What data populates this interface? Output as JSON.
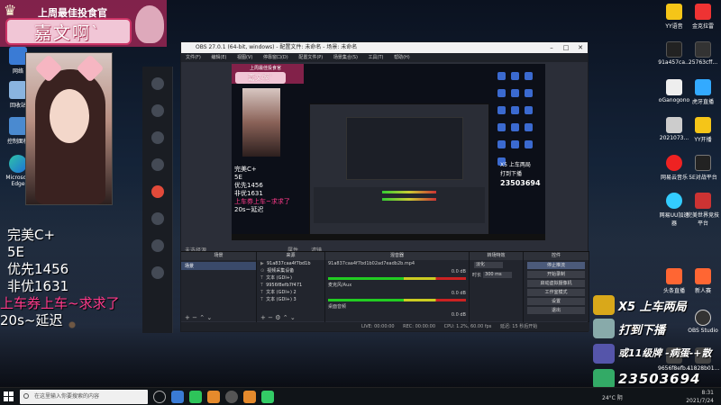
{
  "overlay": {
    "banner_title": "上周最佳投食官",
    "streamer_name": "嘉文啊`",
    "lines": [
      "完美C+",
      "5E",
      "优先1456",
      "非优1631",
      "上车券上车~求求了",
      "20s~延迟"
    ]
  },
  "obs": {
    "title": "OBS 27.0.1 (64-bit, windows) - 配置文件: 未命名 - 场景: 未命名",
    "menu": [
      "文件(F)",
      "编辑(E)",
      "视图(V)",
      "停靠窗口(D)",
      "配置文件(P)",
      "场景集合(S)",
      "工具(T)",
      "帮助(H)"
    ],
    "no_source_label": "未选择源",
    "properties_label": "属性",
    "filters_label": "滤镜",
    "preview": {
      "banner_title": "上周最佳投食官",
      "name": "嘉文啊`",
      "lines": [
        "完美C+",
        "5E",
        "优先1456",
        "非优1631",
        "上车券上车~求求了",
        "20s~延迟"
      ],
      "badges": [
        "X5 上车两局",
        "打到下播",
        "23503694"
      ]
    },
    "docks": {
      "scenes": {
        "title": "场景",
        "items": [
          "场景"
        ]
      },
      "sources": {
        "title": "来源",
        "items": [
          {
            "type": "▶",
            "name": "91a837caa4f7bd1b"
          },
          {
            "type": "⊙",
            "name": "视频采集设备"
          },
          {
            "type": "T",
            "name": "文本 (GDI+)"
          },
          {
            "type": "T",
            "name": "9956f8efb7f471"
          },
          {
            "type": "T",
            "name": "文本 (GDI+) 2"
          },
          {
            "type": "T",
            "name": "文本 (GDI+) 3"
          }
        ]
      },
      "mixer": {
        "title": "混音器",
        "channels": [
          {
            "name": "91a837caa4f7bd1b02ad7eadb2b.mp4",
            "level": "0.0 dB"
          },
          {
            "name": "麦克风/Aux",
            "level": "0.0 dB"
          },
          {
            "name": "桌面音频",
            "level": "0.0 dB"
          }
        ]
      },
      "transitions": {
        "title": "转场特效",
        "fade_label": "淡化",
        "duration_label": "时长",
        "duration_value": "300 ms"
      },
      "controls": {
        "title": "控件",
        "buttons": [
          "停止推流",
          "开始录制",
          "启动虚拟摄像机",
          "工作室模式",
          "设置",
          "退出"
        ]
      }
    },
    "statusbar": [
      "LIVE: 00:00:00",
      "REC: 00:00:00",
      "CPU: 1.2%, 60.00 fps",
      "延迟: 15 秒后开始"
    ]
  },
  "right_overlay": {
    "badges": [
      "X5 上车两局",
      "打到下播",
      "或11级牌 -病蛋-+散",
      "23503694"
    ]
  },
  "desktop_icons_left": [
    "网络",
    "回收站",
    "控制面板",
    "Microsoft Edge"
  ],
  "desktop_icons_right": [
    "YY语音",
    "金克拉雷",
    "91a457ca...",
    "25763cff...",
    "oGanogono",
    "虎牙直播",
    "2021073...",
    "YY开播",
    "网易云音乐",
    "5E对战平台",
    "网易UU加速器",
    "完美世界竞技平台",
    "头条直播",
    "新人赛",
    "OBS Studio",
    "9656f8efb...",
    "41828b01..."
  ],
  "taskbar": {
    "search_placeholder": "在这里输入你要搜索的内容",
    "weather": "24°C 阴",
    "time": "8:31",
    "date": "2021/7/24"
  }
}
